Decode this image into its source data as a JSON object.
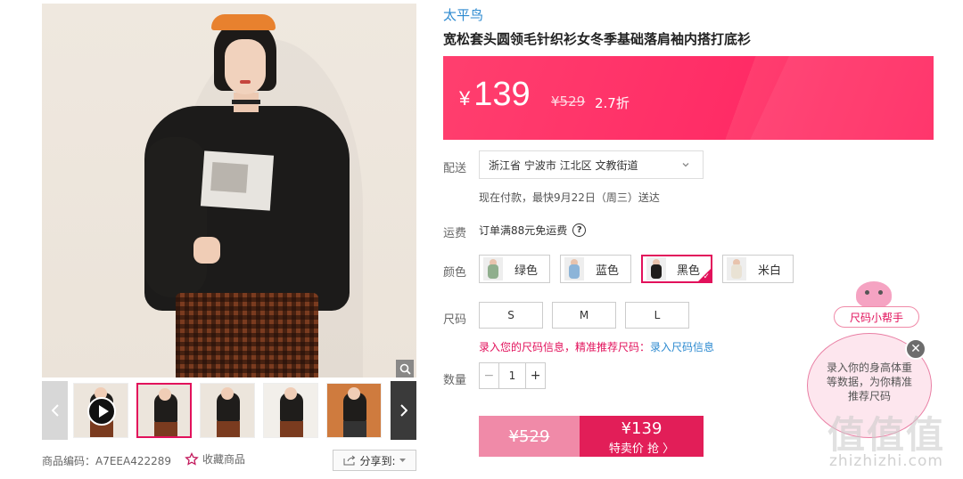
{
  "product": {
    "brand": "太平鸟",
    "title": "宽松套头圆领毛针织衫女冬季基础落肩袖内搭打底衫",
    "currency_symbol": "¥",
    "price": "139",
    "original_price": "¥529",
    "discount": "2.7折"
  },
  "gallery": {
    "sku_label": "商品编码：A7EEA422289",
    "favorite_label": "收藏商品",
    "share_label": "分享到:"
  },
  "delivery": {
    "label": "配送",
    "address": "浙江省 宁波市 江北区 文教街道",
    "eta": "现在付款，最快9月22日（周三）送达"
  },
  "shipping": {
    "label": "运费",
    "text": "订单满88元免运费"
  },
  "colors": {
    "label": "颜色",
    "options": [
      {
        "name": "绿色",
        "swatch": "#8fae8d",
        "selected": false
      },
      {
        "name": "蓝色",
        "swatch": "#8cb4d8",
        "selected": false
      },
      {
        "name": "黑色",
        "swatch": "#1f1d1b",
        "selected": true
      },
      {
        "name": "米白",
        "swatch": "#e9e2d4",
        "selected": false
      }
    ]
  },
  "sizes": {
    "label": "尺码",
    "options": [
      "S",
      "M",
      "L"
    ],
    "tip": "录入您的尺码信息，精准推荐尺码：",
    "tip_link": "录入尺码信息"
  },
  "quantity": {
    "label": "数量",
    "minus": "−",
    "value": "1",
    "plus": "+"
  },
  "buy": {
    "original": "¥529",
    "price": "¥139",
    "action": "特卖价 抢 〉"
  },
  "helper": {
    "tag": "尺码小帮手",
    "message": "录入你的身高体重等数据，为你精准推荐尺码",
    "close": "✕"
  },
  "watermark": {
    "logo": "值值值",
    "url": "zhizhizhi.com"
  },
  "colors_theme": {
    "accent": "#e2115b",
    "price_panel": "#ff2c66",
    "link": "#2d8ad0"
  }
}
